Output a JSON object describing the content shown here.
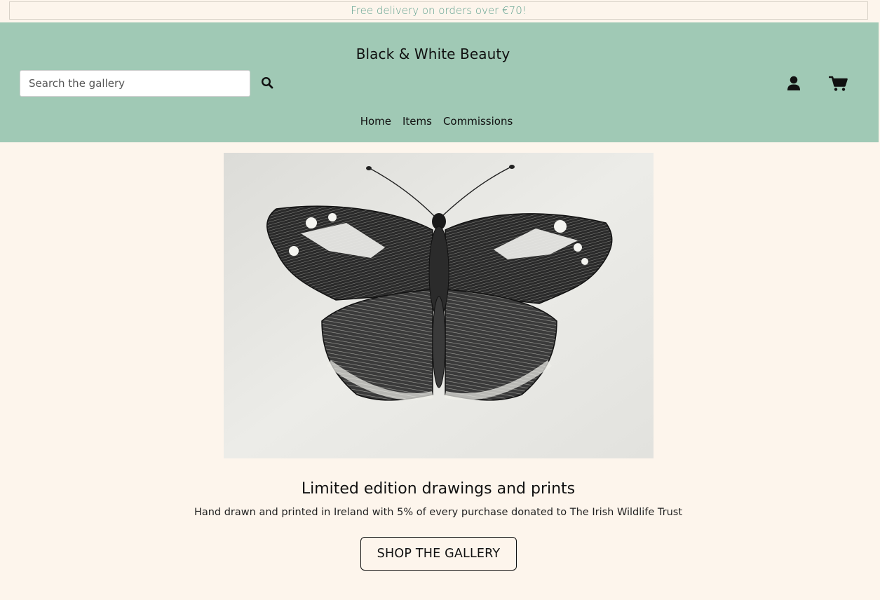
{
  "banner": {
    "text": "Free delivery on orders over €70!"
  },
  "header": {
    "brand": "Black & White Beauty",
    "search": {
      "placeholder": "Search the gallery",
      "value": ""
    },
    "icons": {
      "search": "search-icon",
      "account": "user-icon",
      "cart": "shopping-cart-icon"
    }
  },
  "nav": {
    "items": [
      {
        "label": "Home"
      },
      {
        "label": "Items"
      },
      {
        "label": "Commissions"
      }
    ]
  },
  "hero": {
    "image": "red-admiral-butterfly-ink-drawing"
  },
  "main": {
    "tagline": "Limited edition drawings and prints",
    "subline": "Hand drawn and printed in Ireland with 5% of every purchase donated to The Irish Wildlife Trust",
    "cta_label": "SHOP THE GALLERY"
  },
  "colors": {
    "header_bg": "#a0c9b5",
    "page_bg": "#fdf5ec",
    "banner_text": "#5fa08e"
  }
}
